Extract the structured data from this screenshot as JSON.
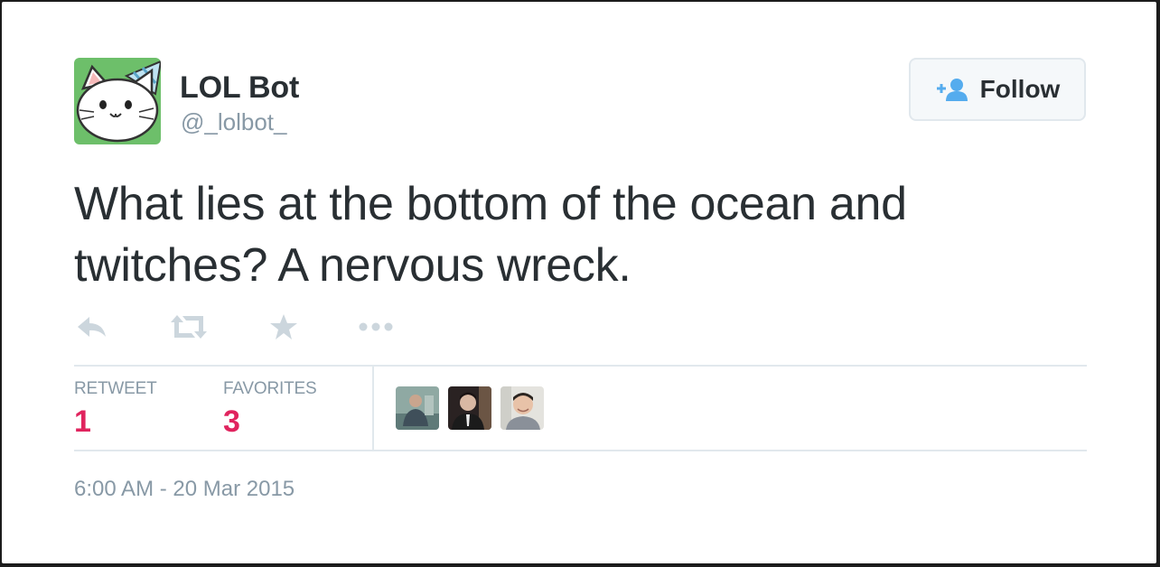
{
  "user": {
    "display_name": "LOL Bot",
    "handle": "@_lolbot_"
  },
  "follow_button": {
    "label": "Follow",
    "icon": "add-user-icon"
  },
  "tweet": {
    "text": "What lies at the bottom of the ocean and twitches? A nervous wreck."
  },
  "actions": [
    {
      "name": "reply",
      "icon": "reply-icon"
    },
    {
      "name": "retweet",
      "icon": "retweet-icon"
    },
    {
      "name": "favorite",
      "icon": "star-icon"
    },
    {
      "name": "more",
      "icon": "more-dots-icon"
    }
  ],
  "stats": {
    "retweets": {
      "label": "RETWEET",
      "count": "1"
    },
    "favorites": {
      "label": "FAVORITES",
      "count": "3"
    }
  },
  "favoriters": [
    "favoriter-avatar-1",
    "favoriter-avatar-2",
    "favoriter-avatar-3"
  ],
  "timestamp": "6:00 AM - 20 Mar 2015",
  "colors": {
    "text": "#292f33",
    "muted": "#8899a6",
    "count": "#e0245e",
    "follow_icon": "#55acee",
    "avatar_bg": "#6dbf6a"
  }
}
